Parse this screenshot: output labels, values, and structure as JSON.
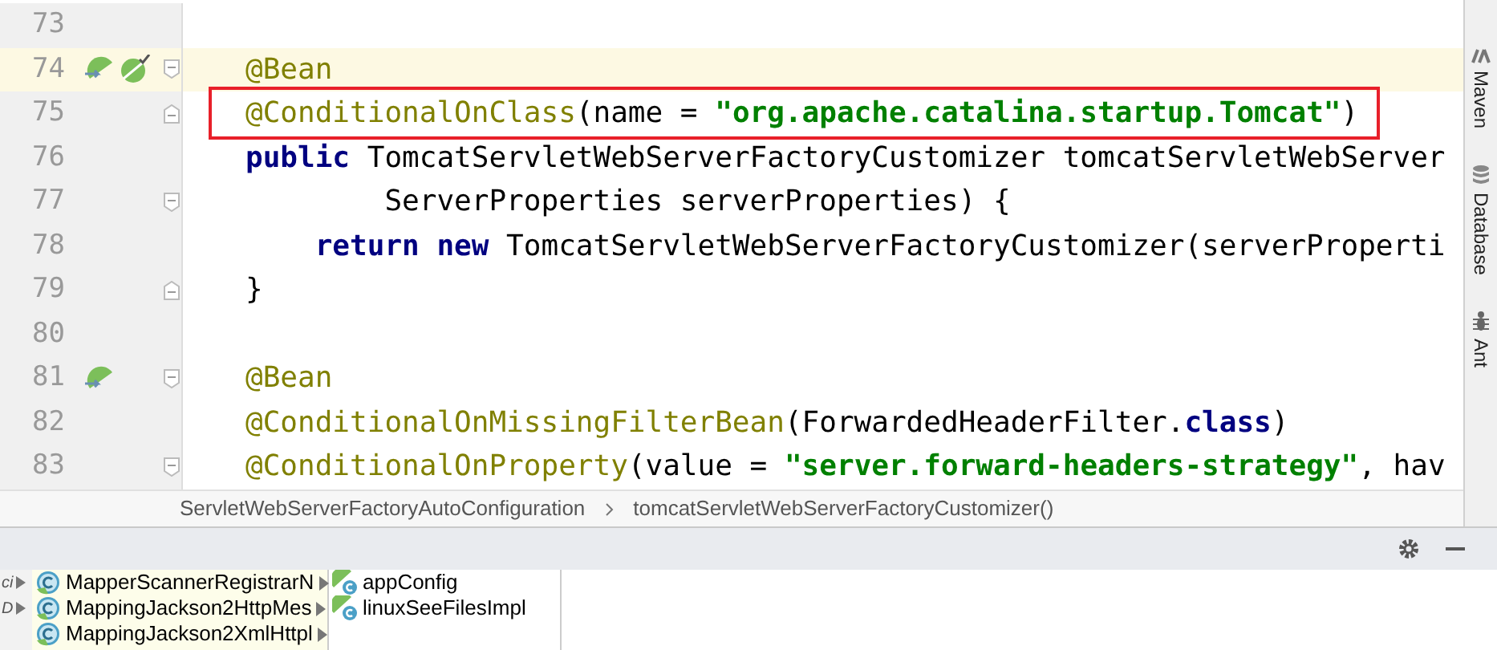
{
  "editor": {
    "lines": [
      {
        "number": "73",
        "current": false,
        "boxed": false
      },
      {
        "number": "74",
        "current": true,
        "boxed": false,
        "fold_open": true,
        "gutter_icons": [
          {
            "kind": "navigate"
          },
          {
            "kind": "check"
          }
        ],
        "tokens": [
          {
            "kind": "annotation",
            "text": "@Bean"
          }
        ]
      },
      {
        "number": "75",
        "current": false,
        "boxed": true,
        "fold_open": false,
        "tokens": [
          {
            "kind": "annotation",
            "text": "@ConditionalOnClass"
          },
          {
            "kind": "plain",
            "text": "(name = "
          },
          {
            "kind": "string",
            "text": "\"org.apache.catalina.startup.Tomcat\""
          },
          {
            "kind": "plain",
            "text": ")"
          }
        ]
      },
      {
        "number": "76",
        "current": false,
        "boxed": false,
        "tokens": [
          {
            "kind": "keyword",
            "text": "public"
          },
          {
            "kind": "plain",
            "text": " TomcatServletWebServerFactoryCustomizer tomcatServletWebServer"
          }
        ]
      },
      {
        "number": "77",
        "current": false,
        "boxed": false,
        "fold_open": true,
        "tokens": [
          {
            "kind": "plain",
            "text": "        ServerProperties serverProperties) {"
          }
        ]
      },
      {
        "number": "78",
        "current": false,
        "boxed": false,
        "tokens": [
          {
            "kind": "keyword",
            "text": "    return new"
          },
          {
            "kind": "plain",
            "text": " TomcatServletWebServerFactoryCustomizer(serverProperti"
          }
        ]
      },
      {
        "number": "79",
        "current": false,
        "boxed": false,
        "fold_open": false,
        "tokens": [
          {
            "kind": "plain",
            "text": "}"
          }
        ]
      },
      {
        "number": "80",
        "current": false,
        "boxed": false
      },
      {
        "number": "81",
        "current": false,
        "boxed": false,
        "fold_open": true,
        "gutter_icons": [
          {
            "kind": "navigate"
          }
        ],
        "tokens": [
          {
            "kind": "annotation",
            "text": "@Bean"
          }
        ]
      },
      {
        "number": "82",
        "current": false,
        "boxed": false,
        "tokens": [
          {
            "kind": "annotation",
            "text": "@ConditionalOnMissingFilterBean"
          },
          {
            "kind": "plain",
            "text": "(ForwardedHeaderFilter."
          },
          {
            "kind": "keyword",
            "text": "class"
          },
          {
            "kind": "plain",
            "text": ")"
          }
        ]
      },
      {
        "number": "83",
        "current": false,
        "boxed": false,
        "fold_open": true,
        "tokens": [
          {
            "kind": "annotation",
            "text": "@ConditionalOnProperty"
          },
          {
            "kind": "plain",
            "text": "(value = "
          },
          {
            "kind": "string",
            "text": "\"server.forward-headers-strategy\""
          },
          {
            "kind": "plain",
            "text": ", hav"
          }
        ]
      }
    ]
  },
  "breadcrumbs": [
    "ServletWebServerFactoryAutoConfiguration",
    "tomcatServletWebServerFactoryCustomizer()"
  ],
  "right_sidebar": [
    "Maven",
    "Database",
    "Ant"
  ],
  "bottom_panel": {
    "column_1": [
      "ci",
      "D"
    ],
    "column_2": [
      {
        "label": "MapperScannerRegistrarN",
        "kind": "class"
      },
      {
        "label": "MappingJackson2HttpMes",
        "kind": "class"
      },
      {
        "label": "MappingJackson2XmlHttpl",
        "kind": "class"
      }
    ],
    "column_3": [
      {
        "label": "appConfig",
        "kind": "bean"
      },
      {
        "label": "linuxSeeFilesImpl",
        "kind": "bean"
      }
    ]
  }
}
